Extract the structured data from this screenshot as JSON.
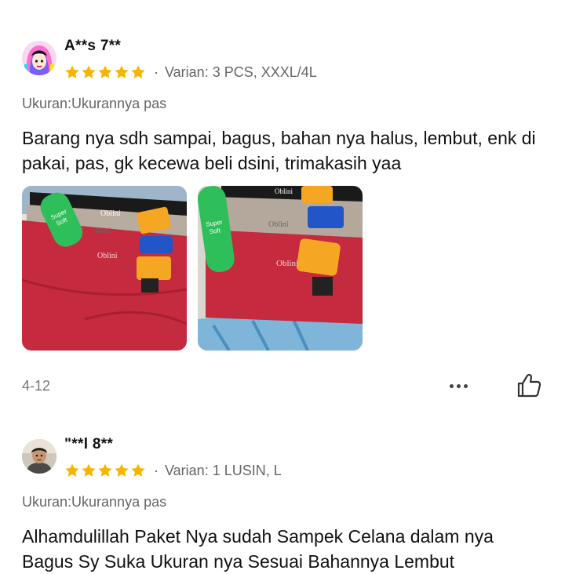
{
  "reviews": [
    {
      "username": "A**s 7**",
      "rating": 5,
      "variant": "Varian: 3 PCS, XXXL/4L",
      "size_note": "Ukuran:Ukurannya pas",
      "text": "Barang nya sdh sampai, bagus, bahan nya halus, lembut, enk di pakai, pas, gk kecewa beli dsini, trimakasih yaa",
      "date": "4-12",
      "photos": [
        "product-photo",
        "product-photo"
      ],
      "photo_labels": [
        "Oblini",
        "Super Soft"
      ]
    },
    {
      "username": "\"**l 8**",
      "rating": 5,
      "variant": "Varian: 1 LUSIN, L",
      "size_note": "Ukuran:Ukurannya pas",
      "text": "Alhamdulillah Paket Nya sudah Sampek Celana dalam nya Bagus Sy Suka Ukuran nya Sesuai Bahannya Lembut"
    }
  ],
  "icons": {
    "star": "star-icon",
    "more": "more-icon",
    "like": "thumbs-up-icon"
  },
  "colors": {
    "star": "#f7b500",
    "text": "#111111",
    "muted": "#666666"
  }
}
